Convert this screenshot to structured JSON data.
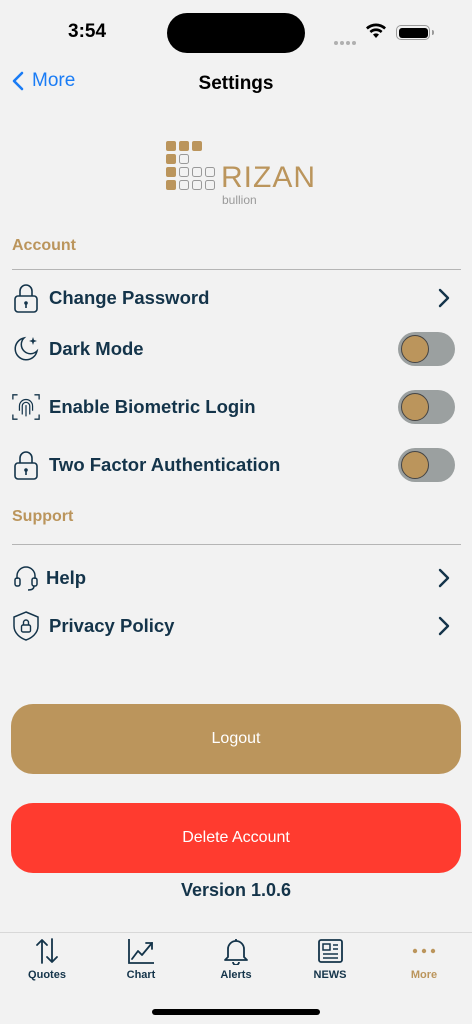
{
  "status": {
    "time": "3:54"
  },
  "nav": {
    "back_label": "More",
    "title": "Settings"
  },
  "logo": {
    "name": "RIZAN",
    "sub": "bullion"
  },
  "sections": {
    "account": {
      "title": "Account",
      "items": [
        {
          "label": "Change Password",
          "type": "link"
        },
        {
          "label": "Dark Mode",
          "type": "toggle"
        },
        {
          "label": "Enable Biometric Login",
          "type": "toggle"
        },
        {
          "label": "Two Factor Authentication",
          "type": "toggle"
        }
      ]
    },
    "support": {
      "title": "Support",
      "items": [
        {
          "label": "Help",
          "type": "link"
        },
        {
          "label": "Privacy Policy",
          "type": "link"
        }
      ]
    }
  },
  "buttons": {
    "logout": "Logout",
    "delete": "Delete Account"
  },
  "version": "Version 1.0.6",
  "tabs": [
    {
      "label": "Quotes",
      "icon": "arrows-updown-icon"
    },
    {
      "label": "Chart",
      "icon": "chart-icon"
    },
    {
      "label": "Alerts",
      "icon": "bell-icon"
    },
    {
      "label": "NEWS",
      "icon": "newspaper-icon"
    },
    {
      "label": "More",
      "icon": "more-dots-icon",
      "active": true
    }
  ],
  "colors": {
    "accent": "#bb955c",
    "text": "#14344a",
    "danger": "#ff3b2f",
    "link": "#1a7cf5"
  }
}
